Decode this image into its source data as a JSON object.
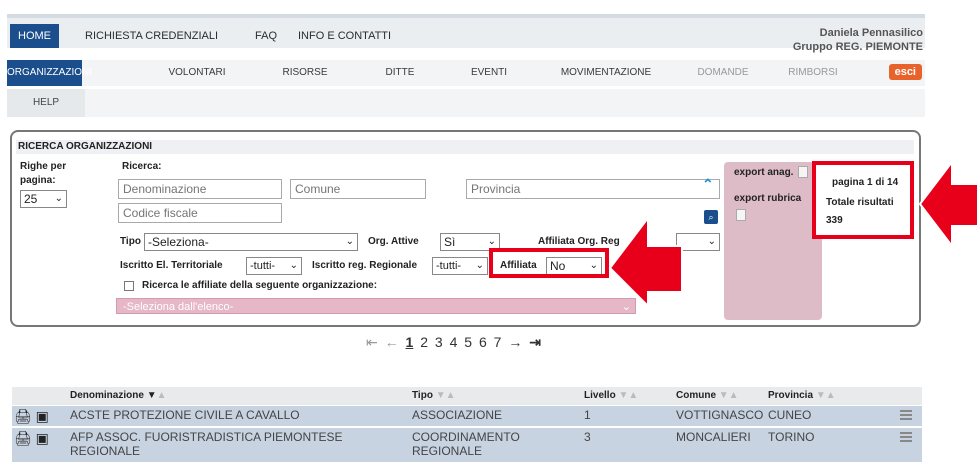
{
  "topnav": {
    "items": [
      "HOME",
      "RICHIESTA CREDENZIALI",
      "FAQ",
      "INFO E CONTATTI"
    ],
    "user_name": "Daniela Pennasilico",
    "user_group": "Gruppo REG. PIEMONTE"
  },
  "nav2": {
    "items": [
      "ORGANIZZAZIONI",
      "VOLONTARI",
      "RISORSE",
      "DITTE",
      "EVENTI",
      "MOVIMENTAZIONE",
      "DOMANDE",
      "RIMBORSI"
    ],
    "esci": "esci",
    "help": "HELP"
  },
  "search": {
    "title": "RICERCA ORGANIZZAZIONI",
    "righe_label1": "Righe per",
    "righe_label2": "pagina:",
    "righe_value": "25",
    "ricerca_label": "Ricerca:",
    "denominazione_ph": "Denominazione",
    "comune_ph": "Comune",
    "provincia_ph": "Provincia",
    "codice_ph": "Codice fiscale",
    "tipo_label": "Tipo",
    "tipo_value": "-Seleziona-",
    "org_attive_label": "Org. Attive",
    "org_attive_value": "Sì",
    "affiliata_org_reg_label": "Affiliata Org. Reg",
    "iscritto_el_label": "Iscritto El. Territoriale",
    "iscritto_el_value": "-tutti-",
    "iscritto_reg_label": "Iscritto reg. Regionale",
    "iscritto_reg_value": "-tutti-",
    "affiliata_label": "Affiliata",
    "affiliata_value": "No",
    "ricerca_affiliate_label": "Ricerca le affiliate della seguente organizzazione:",
    "seleziona_elenco": "-Seleziona dall'elenco-"
  },
  "export": {
    "anag": "export anag.",
    "rubrica": "export rubrica"
  },
  "results": {
    "pagina": "pagina 1 di 14",
    "totale_label": "Totale risultati",
    "totale": "339"
  },
  "pager": {
    "pages": [
      "1",
      "2",
      "3",
      "4",
      "5",
      "6",
      "7"
    ]
  },
  "table": {
    "headers": [
      "Denominazione",
      "Tipo",
      "Livello",
      "Comune",
      "Provincia"
    ],
    "rows": [
      {
        "denominazione": "ACSTE PROTEZIONE CIVILE A CAVALLO",
        "tipo": "ASSOCIAZIONE",
        "livello": "1",
        "comune": "VOTTIGNASCO",
        "provincia": "CUNEO"
      },
      {
        "denominazione": "AFP ASSOC. FUORISTRADISTICA PIEMONTESE REGIONALE",
        "tipo": "COORDINAMENTO REGIONALE",
        "livello": "3",
        "comune": "MONCALIERI",
        "provincia": "TORINO"
      }
    ]
  },
  "colors": {
    "primary": "#1a4e8c",
    "highlight": "#e8001a",
    "export_bg": "#ddbcc8",
    "esci": "#e8632b"
  }
}
